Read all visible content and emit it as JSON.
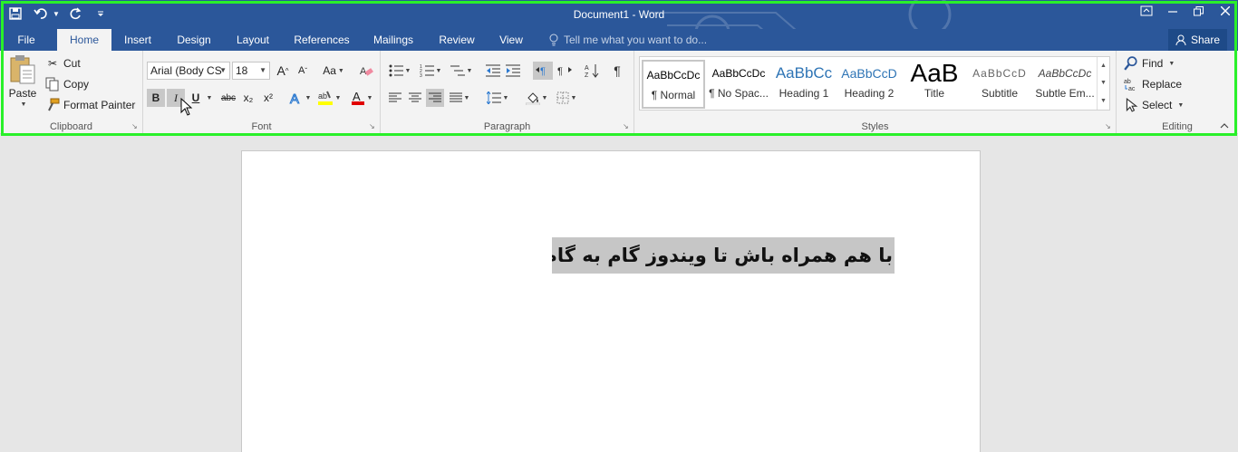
{
  "window": {
    "title": "Document1 - Word"
  },
  "tabs": [
    {
      "label": "File",
      "active": false
    },
    {
      "label": "Home",
      "active": true
    },
    {
      "label": "Insert",
      "active": false
    },
    {
      "label": "Design",
      "active": false
    },
    {
      "label": "Layout",
      "active": false
    },
    {
      "label": "References",
      "active": false
    },
    {
      "label": "Mailings",
      "active": false
    },
    {
      "label": "Review",
      "active": false
    },
    {
      "label": "View",
      "active": false
    }
  ],
  "tellme": {
    "placeholder": "Tell me what you want to do..."
  },
  "share": {
    "label": "Share"
  },
  "clipboard": {
    "paste_label": "Paste",
    "cut_label": "Cut",
    "copy_label": "Copy",
    "format_painter_label": "Format Painter",
    "group_label": "Clipboard"
  },
  "font": {
    "font_name": "Arial (Body CS",
    "font_size": "18",
    "bold_label": "B",
    "italic_label": "I",
    "underline_label": "U",
    "strike_label": "abc",
    "subscript_label": "x₂",
    "superscript_label": "x²",
    "grow_label": "A",
    "shrink_label": "A",
    "case_label": "Aa",
    "color_label": "A",
    "group_label": "Font"
  },
  "paragraph": {
    "group_label": "Paragraph",
    "pilcrow": "¶"
  },
  "styles": {
    "group_label": "Styles",
    "items": [
      {
        "preview": "AaBbCcDc",
        "name": "¶ Normal",
        "selected": true
      },
      {
        "preview": "AaBbCcDc",
        "name": "¶ No Spac...",
        "selected": false
      },
      {
        "preview": "AaBbCc",
        "name": "Heading 1",
        "selected": false
      },
      {
        "preview": "AaBbCcD",
        "name": "Heading 2",
        "selected": false
      },
      {
        "preview": "AaB",
        "name": "Title",
        "selected": false
      },
      {
        "preview": "AaBbCcD",
        "name": "Subtitle",
        "selected": false
      },
      {
        "preview": "AaBbCcDc",
        "name": "Subtle Em...",
        "selected": false
      }
    ]
  },
  "editing": {
    "find_label": "Find",
    "replace_label": "Replace",
    "select_label": "Select",
    "group_label": "Editing"
  },
  "document": {
    "text": "با هم همراه باش تا ویندوز گام به گام یاد بگیری"
  },
  "colors": {
    "accent": "#2b579a",
    "highlight_border": "#29f029",
    "highlight_yellow": "#ffff00",
    "font_red": "#e00000"
  }
}
